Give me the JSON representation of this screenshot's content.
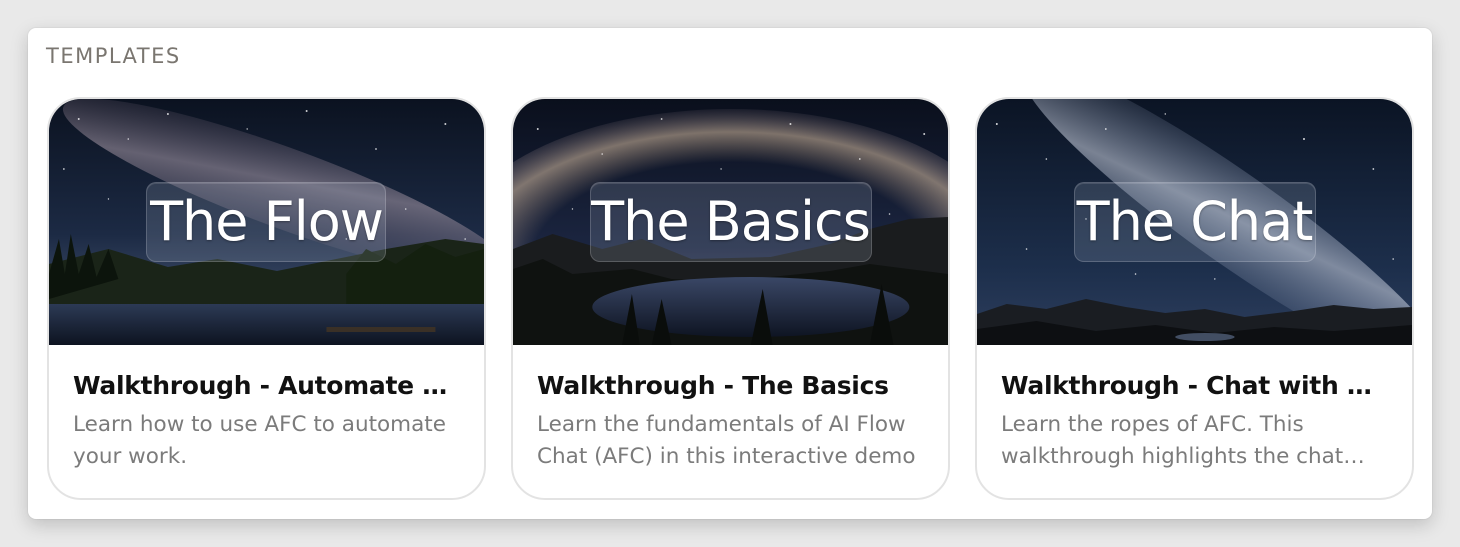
{
  "section": {
    "title": "TEMPLATES"
  },
  "cards": [
    {
      "image_label": "The Flow",
      "title": "Walkthrough - Automate with AFC",
      "description": "Learn how to use AFC to automate your work."
    },
    {
      "image_label": "The Basics",
      "title": "Walkthrough - The Basics",
      "description": "Learn the fundamentals of AI Flow Chat (AFC) in this interactive demo"
    },
    {
      "image_label": "The Chat",
      "title": "Walkthrough - Chat with any AI model",
      "description": "Learn the ropes of AFC. This walkthrough highlights the chat features."
    }
  ],
  "colors": {
    "panel_bg": "#ffffff",
    "page_bg": "#e9e9e9",
    "title_text": "#111111",
    "desc_text": "#7b7b7b",
    "section_text": "#7a7670"
  }
}
